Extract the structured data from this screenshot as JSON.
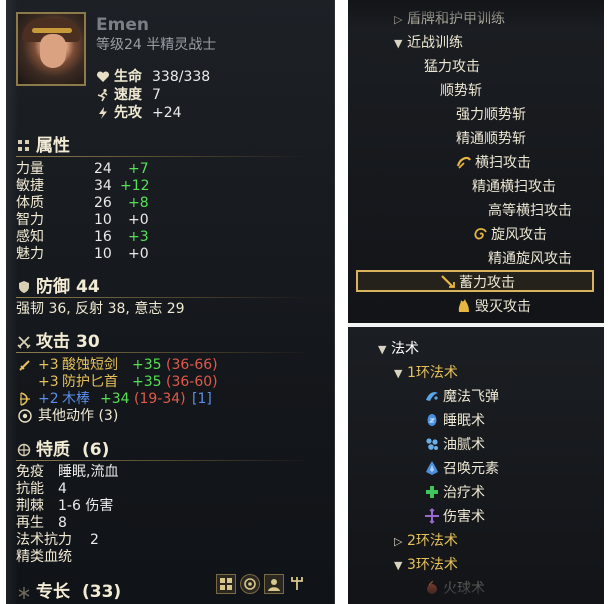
{
  "character": {
    "name": "Emen",
    "subtitle": "等级24 半精灵战士",
    "hp_label": "生命",
    "hp_value": "338/338",
    "speed_label": "速度",
    "speed_value": "7",
    "initiative_label": "先攻",
    "initiative_value": "+24"
  },
  "attributes": {
    "title": "属性",
    "rows": [
      {
        "label": "力量",
        "value": "24",
        "bonus": "+7"
      },
      {
        "label": "敏捷",
        "value": "34",
        "bonus": "+12"
      },
      {
        "label": "体质",
        "value": "26",
        "bonus": "+8"
      },
      {
        "label": "智力",
        "value": "10",
        "bonus": "+0"
      },
      {
        "label": "感知",
        "value": "16",
        "bonus": "+3"
      },
      {
        "label": "魅力",
        "value": "10",
        "bonus": "+0"
      }
    ]
  },
  "defense": {
    "title": "防御",
    "value": "44",
    "saves": "强韧 36, 反射 38, 意志 29"
  },
  "attack": {
    "title": "攻击",
    "value": "30",
    "weapons": [
      {
        "enchant": "+3",
        "name": "酸蚀短剑",
        "hit": "+35",
        "dmg": "(36-66)",
        "color": "#e6c15a"
      },
      {
        "enchant": "+3",
        "name": "防护匕首",
        "hit": "+35",
        "dmg": "(36-60)",
        "color": "#e6c15a"
      },
      {
        "enchant": "+2",
        "name": "木棒",
        "hit": "+34",
        "dmg": "(19-34)",
        "extra": "[1]",
        "color": "#5a8ee8"
      }
    ],
    "other_actions": "其他动作 (3)"
  },
  "traits": {
    "title": "特质",
    "count": "(6)",
    "rows": [
      {
        "label": "免疫",
        "value": "睡眠,流血"
      },
      {
        "label": "抗能",
        "value": "4"
      },
      {
        "label": "荆棘",
        "value": "1-6 伤害"
      },
      {
        "label": "再生",
        "value": "8"
      },
      {
        "label": "法术抗力",
        "value": "2"
      },
      {
        "label": "精类血统",
        "value": ""
      }
    ]
  },
  "specialties": {
    "title": "专长",
    "count": "(33)"
  },
  "skill_tree": {
    "items": [
      {
        "text": "盾牌和护甲训练",
        "indent": 46,
        "arrow": "▷",
        "icon": ""
      },
      {
        "text": "近战训练",
        "indent": 46,
        "arrow": "▼",
        "icon": ""
      },
      {
        "text": "猛力攻击",
        "indent": 76,
        "arrow": "",
        "icon": ""
      },
      {
        "text": "顺势斩",
        "indent": 92,
        "arrow": "",
        "icon": ""
      },
      {
        "text": "强力顺势斩",
        "indent": 108,
        "arrow": "",
        "icon": ""
      },
      {
        "text": "精通顺势斩",
        "indent": 108,
        "arrow": "",
        "icon": ""
      },
      {
        "text": "横扫攻击",
        "indent": 108,
        "arrow": "",
        "icon": "sweep-attack-icon"
      },
      {
        "text": "精通横扫攻击",
        "indent": 124,
        "arrow": "",
        "icon": ""
      },
      {
        "text": "高等横扫攻击",
        "indent": 140,
        "arrow": "",
        "icon": ""
      },
      {
        "text": "旋风攻击",
        "indent": 124,
        "arrow": "",
        "icon": "whirlwind-attack-icon"
      },
      {
        "text": "精通旋风攻击",
        "indent": 140,
        "arrow": "",
        "icon": ""
      },
      {
        "text": "蓄力攻击",
        "indent": 92,
        "arrow": "",
        "icon": "charge-attack-icon"
      },
      {
        "text": "毁灭攻击",
        "indent": 108,
        "arrow": "",
        "icon": "devastating-attack-icon"
      }
    ]
  },
  "spell_tree": {
    "items": [
      {
        "text": "法术",
        "indent": 30,
        "arrow": "▼",
        "icon": "",
        "style": "header"
      },
      {
        "text": "1环法术",
        "indent": 46,
        "arrow": "▼",
        "icon": "",
        "style": "gold"
      },
      {
        "text": "魔法飞弹",
        "indent": 76,
        "arrow": "",
        "icon": "magic-missile-icon",
        "style": ""
      },
      {
        "text": "睡眠术",
        "indent": 76,
        "arrow": "",
        "icon": "sleep-icon",
        "style": ""
      },
      {
        "text": "油腻术",
        "indent": 76,
        "arrow": "",
        "icon": "grease-icon",
        "style": ""
      },
      {
        "text": "召唤元素",
        "indent": 76,
        "arrow": "",
        "icon": "summon-elemental-icon",
        "style": ""
      },
      {
        "text": "治疗术",
        "indent": 76,
        "arrow": "",
        "icon": "cure-icon",
        "style": ""
      },
      {
        "text": "伤害术",
        "indent": 76,
        "arrow": "",
        "icon": "inflict-icon",
        "style": ""
      },
      {
        "text": "2环法术",
        "indent": 46,
        "arrow": "▷",
        "icon": "",
        "style": "gold"
      },
      {
        "text": "3环法术",
        "indent": 46,
        "arrow": "▼",
        "icon": "",
        "style": "gold"
      },
      {
        "text": "火球术",
        "indent": 76,
        "arrow": "",
        "icon": "fireball-icon",
        "style": "dim"
      }
    ]
  },
  "colors": {
    "accent_gold": "#e6c15a",
    "bonus_green": "#56e056",
    "damage_red": "#e05a4a",
    "blue_item": "#5a8ee8",
    "highlight_border": "#d9b45c"
  }
}
